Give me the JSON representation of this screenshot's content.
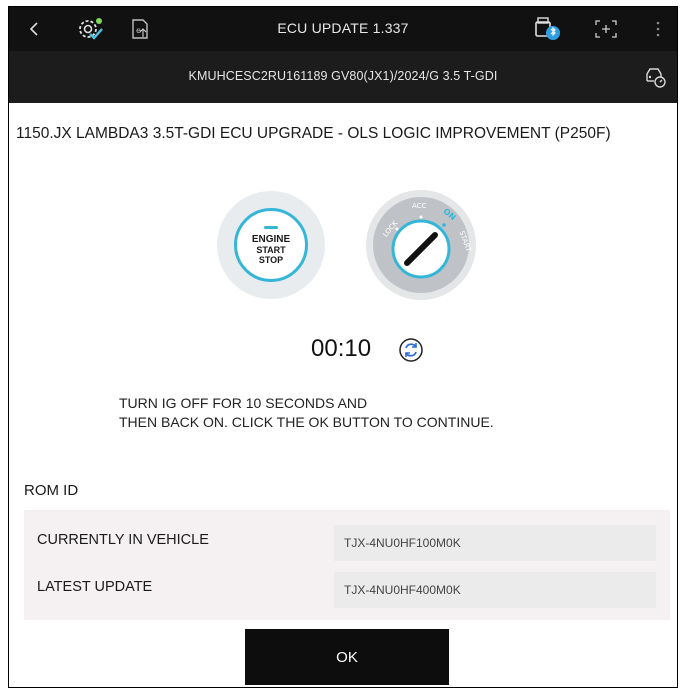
{
  "topbar": {
    "title": "ECU UPDATE 1.337",
    "icons": [
      "back-chevron-icon",
      "settings-check-icon",
      "ecu-export-icon",
      "vci-bluetooth-icon",
      "screen-capture-icon",
      "more-vertical-icon"
    ]
  },
  "vehicle": {
    "info": "KMUHCESC2RU161189  GV80(JX1)/2024/G 3.5 T-GDI",
    "icon": "car-gauge-icon"
  },
  "heading": "1150.JX LAMBDA3 3.5T-GDI ECU UPGRADE - OLS LOGIC IMPROVEMENT (P250F)",
  "engine_button": {
    "line1": "ENGINE",
    "line2": "START",
    "line3": "STOP"
  },
  "ignition": {
    "positions": [
      "LOCK",
      "ACC",
      "ON",
      "START"
    ],
    "active": "ON"
  },
  "timer": "00:10",
  "instruction": {
    "line1": "TURN IG OFF FOR 10 SECONDS AND",
    "line2": "THEN BACK ON. CLICK THE OK BUTTON TO CONTINUE."
  },
  "rom": {
    "title": "ROM ID",
    "rows": [
      {
        "label": "CURRENTLY IN VEHICLE",
        "value": "TJX-4NU0HF100M0K"
      },
      {
        "label": "LATEST UPDATE",
        "value": "TJX-4NU0HF400M0K"
      }
    ]
  },
  "ok_label": "OK",
  "colors": {
    "accent": "#35b6d8",
    "topbar": "#111111",
    "subbar": "#1c1c1c"
  }
}
